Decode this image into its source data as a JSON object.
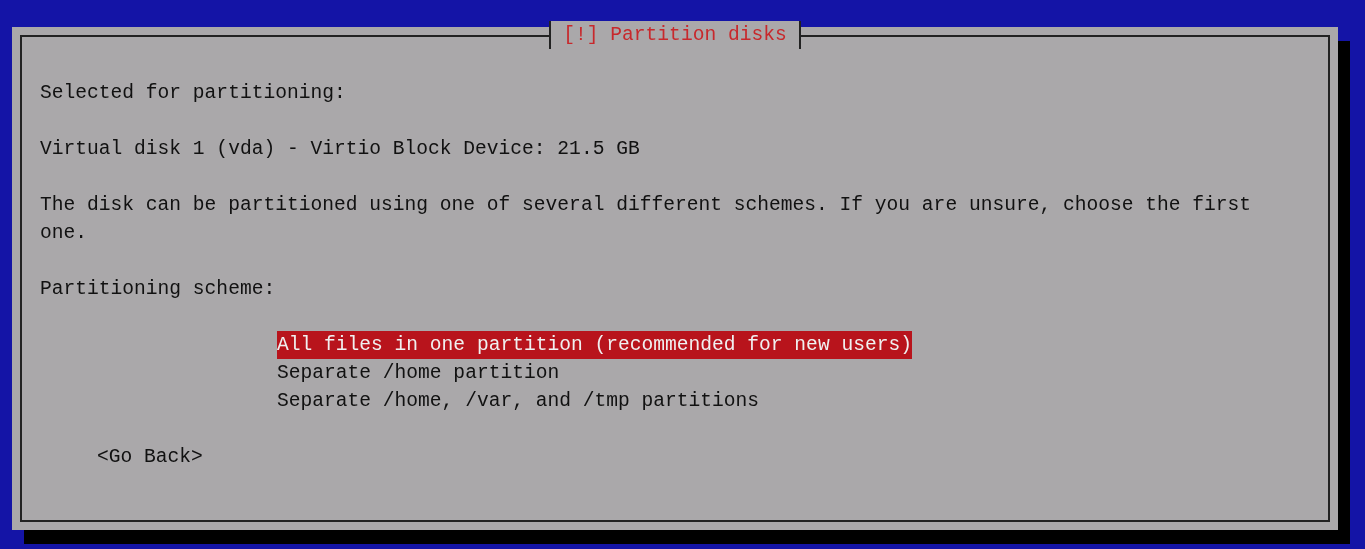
{
  "dialog": {
    "title": "[!] Partition disks",
    "paragraphs": [
      "Selected for partitioning:",
      "Virtual disk 1 (vda) - Virtio Block Device: 21.5 GB",
      "The disk can be partitioned using one of several different schemes. If you are unsure, choose the first one."
    ],
    "prompt": "Partitioning scheme:",
    "options": [
      {
        "label": "All files in one partition (recommended for new users)",
        "selected": true
      },
      {
        "label": "Separate /home partition",
        "selected": false
      },
      {
        "label": "Separate /home, /var, and /tmp partitions",
        "selected": false
      }
    ],
    "buttons": [
      "<Go Back>"
    ]
  }
}
